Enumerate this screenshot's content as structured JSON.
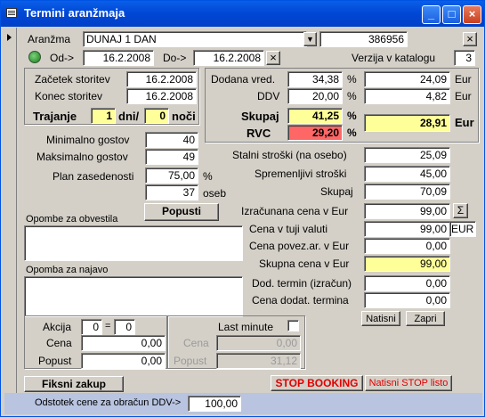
{
  "window": {
    "title": "Termini aranžmaja"
  },
  "aranzma": {
    "label": "Aranžma",
    "value": "DUNAJ 1 DAN",
    "id": "386956"
  },
  "od": {
    "label": "Od->",
    "value": "16.2.2008"
  },
  "do": {
    "label": "Do->",
    "value": "16.2.2008"
  },
  "verzija": {
    "label": "Verzija v katalogu",
    "value": "3"
  },
  "zacetek": {
    "label": "Začetek storitev",
    "value": "16.2.2008"
  },
  "konec": {
    "label": "Konec storitev",
    "value": "16.2.2008"
  },
  "trajanje": {
    "label": "Trajanje",
    "dni_value": "1",
    "dni_label": "dni/",
    "noci_value": "0",
    "noci_label": "noči"
  },
  "dodana": {
    "label": "Dodana vred.",
    "value": "34,38",
    "unit": "%",
    "eur_value": "24,09",
    "eur_unit": "Eur"
  },
  "ddv": {
    "label": "DDV",
    "value": "20,00",
    "unit": "%",
    "eur_value": "4,82",
    "eur_unit": "Eur"
  },
  "skupaj_pct": {
    "label": "Skupaj",
    "value": "41,25",
    "unit": "%"
  },
  "rvc": {
    "label": "RVC",
    "value": "29,20",
    "unit": "%",
    "eur_value": "28,91",
    "eur_unit": "Eur"
  },
  "min_gostov": {
    "label": "Minimalno gostov",
    "value": "40"
  },
  "max_gostov": {
    "label": "Maksimalno gostov",
    "value": "49"
  },
  "plan": {
    "label": "Plan zasedenosti",
    "value": "75,00",
    "unit": "%",
    "oseb_value": "37",
    "oseb_label": "oseb"
  },
  "popusti_button": "Popusti",
  "stalni": {
    "label": "Stalni stroški (na osebo)",
    "value": "25,09"
  },
  "spremenljivi": {
    "label": "Spremenljivi stroški",
    "value": "45,00"
  },
  "skupaj": {
    "label": "Skupaj",
    "value": "70,09"
  },
  "izracunana": {
    "label": "Izračunana cena v Eur",
    "value": "99,00",
    "sigma": "Σ"
  },
  "tuji": {
    "label": "Cena v tuji valuti",
    "value": "99,00",
    "currency": "EUR"
  },
  "povez": {
    "label": "Cena povez.ar. v Eur",
    "value": "0,00"
  },
  "skupna": {
    "label": "Skupna cena v Eur",
    "value": "99,00"
  },
  "dod_termin": {
    "label": "Dod. termin (izračun)",
    "value": "0,00"
  },
  "cena_dodat": {
    "label": "Cena dodat. termina",
    "value": "0,00"
  },
  "opombe_obvestila": {
    "label": "Opombe za obvestila",
    "value": ""
  },
  "opomba_najavo": {
    "label": "Opomba za najavo",
    "value": ""
  },
  "natisni_button": "Natisni",
  "zapri_button": "Zapri",
  "akcija": {
    "label": "Akcija",
    "a": "0",
    "eq": "=",
    "b": "0"
  },
  "akcija_cena": {
    "label": "Cena",
    "value": "0,00"
  },
  "akcija_popust": {
    "label": "Popust",
    "value": "0,00"
  },
  "last_minute": {
    "label": "Last minute",
    "cena_label": "Cena",
    "cena_value": "0,00",
    "popust_label": "Popust",
    "popust_value": "31,12"
  },
  "fiksni_button": "Fiksni zakup",
  "stop_booking_button": "STOP BOOKING",
  "natisni_stop_button": "Natisni STOP listo",
  "odstotek": {
    "label": "Odstotek cene za  obračun DDV->",
    "value": "100,00"
  },
  "title_buttons": {
    "minimize": "_",
    "maximize": "□",
    "close": "×"
  },
  "clear_glyph": "×"
}
